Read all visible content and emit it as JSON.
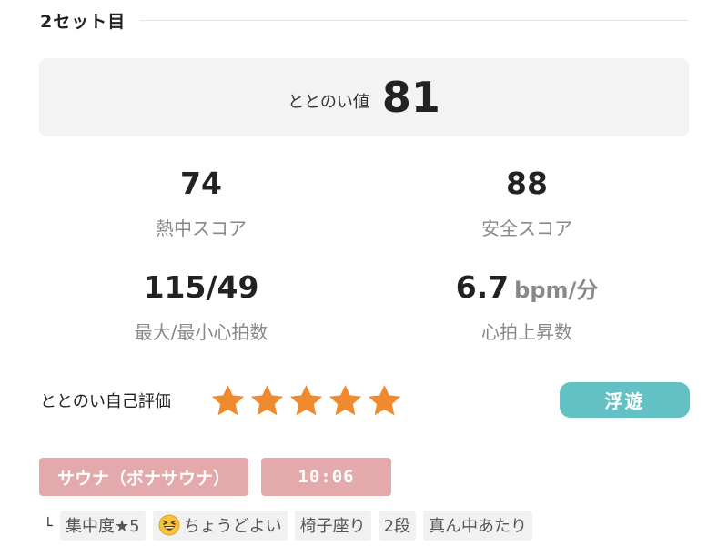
{
  "set_header": {
    "title": "2セット目"
  },
  "totonoi_score": {
    "label": "ととのい値",
    "value": "81"
  },
  "metrics": [
    {
      "value": "74",
      "unit": "",
      "label": "熱中スコア"
    },
    {
      "value": "88",
      "unit": "",
      "label": "安全スコア"
    },
    {
      "value": "115/49",
      "unit": "",
      "label": "最大/最小心拍数"
    },
    {
      "value": "6.7",
      "unit": "bpm/分",
      "label": "心拍上昇数"
    }
  ],
  "self_rating": {
    "label": "ととのい自己評価",
    "stars": 5,
    "max_stars": 5,
    "star_color": "#f08a2f",
    "mood": "浮遊",
    "mood_color": "#63c1c4"
  },
  "sauna": {
    "name": "サウナ（ボナサウナ）",
    "time": "10:06",
    "pill_color": "#e3a9ab"
  },
  "tags": {
    "branch_symbol": "└",
    "items": [
      {
        "text": "集中度★5",
        "icon": ""
      },
      {
        "text": "ちょうどよい",
        "icon": "grinning-squinting-face-icon"
      },
      {
        "text": "椅子座り",
        "icon": ""
      },
      {
        "text": "2段",
        "icon": ""
      },
      {
        "text": "真ん中あたり",
        "icon": ""
      }
    ]
  }
}
